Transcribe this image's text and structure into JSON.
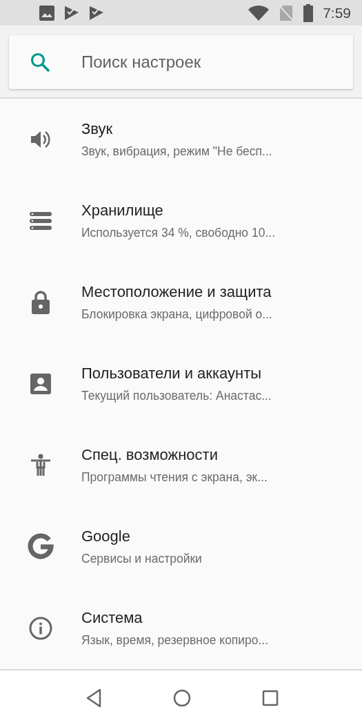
{
  "status_bar": {
    "time": "7:59"
  },
  "search": {
    "placeholder": "Поиск настроек"
  },
  "items": [
    {
      "kind": "sound",
      "title": "Звук",
      "subtitle": "Звук, вибрация, режим \"Не бесп..."
    },
    {
      "kind": "storage",
      "title": "Хранилище",
      "subtitle": "Используется 34 %, свободно 10..."
    },
    {
      "kind": "lock",
      "title": "Местоположение и защита",
      "subtitle": "Блокировка экрана, цифровой о..."
    },
    {
      "kind": "account",
      "title": "Пользователи и аккаунты",
      "subtitle": "Текущий пользователь: Анастас..."
    },
    {
      "kind": "accessibility",
      "title": "Спец. возможности",
      "subtitle": "Программы чтения с экрана, эк..."
    },
    {
      "kind": "google",
      "title": "Google",
      "subtitle": "Сервисы и настройки"
    },
    {
      "kind": "info",
      "title": "Система",
      "subtitle": "Язык, время, резервное копиро..."
    }
  ]
}
